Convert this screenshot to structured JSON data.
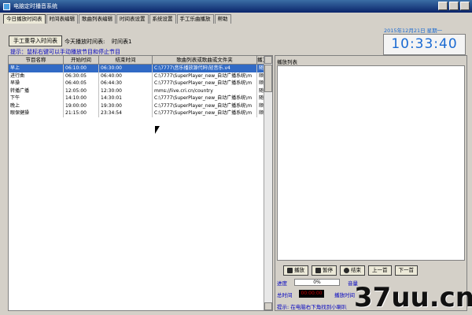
{
  "window": {
    "title": "电脑定时播音系统"
  },
  "tabs": [
    {
      "label": "今日播放时间表"
    },
    {
      "label": "时间表编辑"
    },
    {
      "label": "歌曲列表编辑"
    },
    {
      "label": "时间表设置"
    },
    {
      "label": "系统设置"
    },
    {
      "label": "手工乐曲播放"
    },
    {
      "label": "帮助"
    }
  ],
  "toolbar": {
    "import_label": "手工重导入时间表",
    "today_label": "今天播放时间表:",
    "today_value": "时间表1",
    "hint": "提示：鼠标右键可以手动播放节目和停止节目"
  },
  "clock": {
    "date": "2015年12月21日 星期一",
    "time": "10:33:40"
  },
  "table": {
    "headers": [
      "节目名称",
      "开始时间",
      "结束时间",
      "歌曲列表或歌曲或文件夹",
      "播方"
    ],
    "rows": [
      [
        "早上",
        "06:10:00",
        "06:30:00",
        "C:\\7777\\音乐播放源代码\\轻音乐.v4",
        "随机"
      ],
      [
        "进行曲",
        "06:30:05",
        "06:40:00",
        "C:\\7777\\SuperPlayer_new_自动广播系统\\m",
        "顺序"
      ],
      [
        "早操",
        "06:40:05",
        "06:44:30",
        "C:\\7777\\SuperPlayer_new_自动广播系统\\m",
        "顺序"
      ],
      [
        "转播广播",
        "12:05:00",
        "12:30:00",
        "mms://live.cri.cn/country",
        "随机"
      ],
      [
        "下午",
        "14:10:00",
        "14:30:01",
        "C:\\7777\\SuperPlayer_new_自动广播系统\\m",
        "随机"
      ],
      [
        "晚上",
        "19:00:00",
        "19:30:00",
        "C:\\7777\\SuperPlayer_new_自动广播系统\\m",
        "顺序"
      ],
      [
        "眼保健操",
        "21:15:00",
        "23:34:54",
        "C:\\7777\\SuperPlayer_new_自动广播系统\\m",
        "顺序"
      ]
    ]
  },
  "playpanel": {
    "title": "播放列表",
    "buttons": {
      "play": "播放",
      "pause": "暂停",
      "stop": "结束",
      "prev": "上一首",
      "next": "下一首"
    },
    "progress_label": "进度",
    "progress_value": "0%",
    "volume_label": "音量",
    "total_label": "总时间",
    "total_value": "00:00:00",
    "played_label": "播放时间",
    "hint": "提示: 在电脑右下角找到小喇叭"
  },
  "watermark": "37uu.cn"
}
